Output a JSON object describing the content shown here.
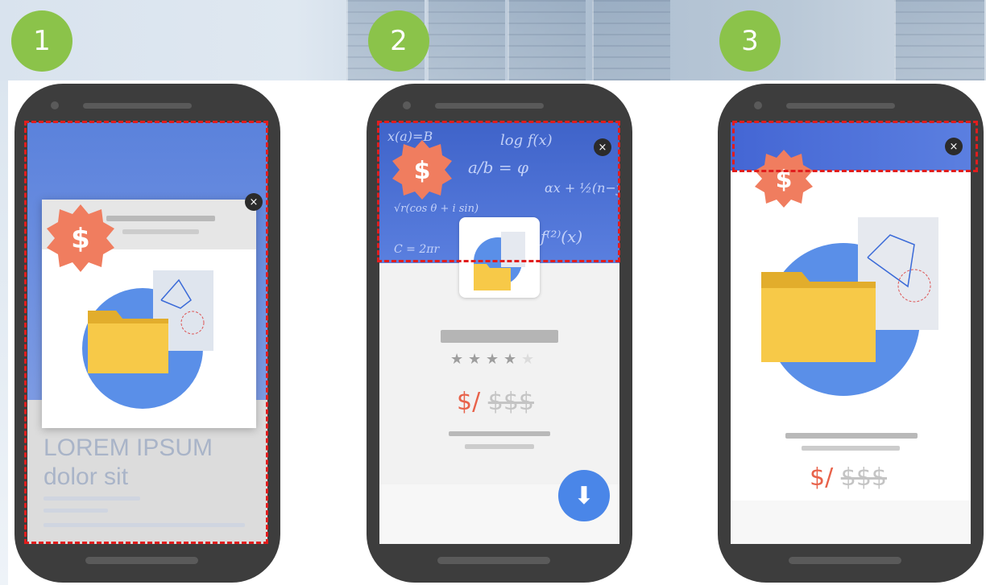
{
  "badges": [
    "1",
    "2",
    "3"
  ],
  "phone1": {
    "headline": "LOREM IPSUM",
    "subline": "dolor sit",
    "close_symbol": "×"
  },
  "phone2": {
    "price_now": "$/",
    "price_was": "$$$",
    "stars_filled": 4,
    "stars_total": 5,
    "close_symbol": "×",
    "download_symbol": "⬇"
  },
  "phone3": {
    "price_now": "$/",
    "price_was": "$$$",
    "close_symbol": "×"
  },
  "colors": {
    "badge": "#8bc34a",
    "dashed_outline": "#e11d1d",
    "coupon": "#f07d5f",
    "header_blue": "#4a6fd8",
    "folder": "#f7c948",
    "circle_blue": "#5a8fe8",
    "price": "#e8624a"
  },
  "icons": [
    "close-icon",
    "coupon-icon",
    "folder-icon",
    "download-icon",
    "star-icon"
  ]
}
